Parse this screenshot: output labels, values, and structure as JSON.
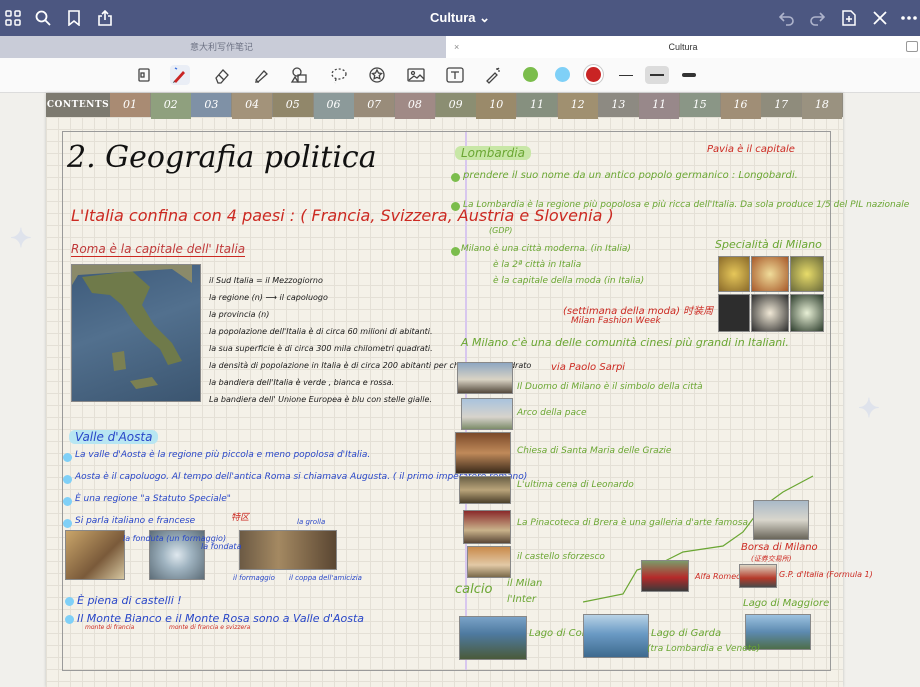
{
  "app": {
    "title": "Cultura",
    "tabs": [
      {
        "label": "意大利写作笔记"
      },
      {
        "label": "Cultura"
      }
    ]
  },
  "titlebar": {
    "icons": [
      "grid-icon",
      "search-icon",
      "bookmark-icon",
      "share-icon",
      "undo-icon",
      "redo-icon",
      "add-page-icon",
      "close-icon",
      "more-icon"
    ]
  },
  "toolbar": {
    "tools": [
      "reader-icon",
      "pen-icon",
      "eraser-icon",
      "highlighter-icon",
      "shapes-icon",
      "lasso-icon",
      "sticker-icon",
      "image-icon",
      "text-icon",
      "laser-icon"
    ],
    "colors": [
      "#7bbd4c",
      "#7fd0f7",
      "#c92424"
    ]
  },
  "notebook": {
    "tab_first": "CONTENTS",
    "tabs": [
      "01",
      "02",
      "03",
      "04",
      "05",
      "06",
      "07",
      "08",
      "09",
      "10",
      "11",
      "12",
      "13",
      "11",
      "15",
      "16",
      "17",
      "18"
    ]
  },
  "left": {
    "heading": "2. Geografia politica",
    "confini": "L'Italia confina con 4 paesi : ( Francia, Svizzera, Austria e Slovenia )",
    "roma": "Roma è la capitale dell' Italia",
    "facts": [
      "il Sud Italia = il Mezzogiorno",
      "la regione (n) ⟶ il capoluogo",
      "la provincia (n)",
      "la popolazione dell'Italia è di circa 60 milioni di abitanti.",
      "la sua superficie è di circa 300 mila chilometri quadrati.",
      "la densità di popolazione in Italia è di circa 200 abitanti per chilometro quadrato",
      "la bandiera dell'Italia è verde , bianca e rossa.",
      "La bandiera dell' Unione Europea è blu con stelle gialle."
    ],
    "aosta_heading": "Valle d'Aosta",
    "aosta": [
      "La valle d'Aosta è la regione più piccola e meno popolosa d'Italia.",
      "Aosta è il capoluogo. Al tempo dell'antica Roma si chiamava Augusta. ( il primo imperatore romano)",
      "È una regione \"a Statuto Speciale\"",
      "Si parla italiano e francese"
    ],
    "aosta_note": "特区",
    "aosta_labels": [
      "la fonduta (un formaggio)",
      "la fondata",
      "la grolla",
      "il formaggio",
      "il coppa dell'amicizia"
    ],
    "aosta_end": [
      "È piena di castelli !",
      "Il Monte Bianco e il Monte Rosa sono a Valle d'Aosta"
    ],
    "aosta_small": [
      "monte di francia",
      "monte di francia e svizzera"
    ]
  },
  "right": {
    "heading": "Lombardia",
    "pavia": "Pavia è il capitale",
    "lombardia": [
      "prendere il suo nome da un antico popolo germanico : Longobardi.",
      "La Lombardia è la regione più popolosa e più ricca dell'Italia. Da sola produce 1/5 del PIL nazionale",
      "(GDP)",
      "Milano è una città moderna. (in Italia)",
      "è la 2ª città in Italia",
      "è la capitale della moda (in Italia)"
    ],
    "settimana": "(settimana della moda) 时装周",
    "fashion_week": "Milan Fashion Week",
    "specialita": "Specialità di Milano",
    "milano_vie": "A Milano c'è una delle comunità cinesi più grandi in Italiani.",
    "via_paolo": "via Paolo Sarpi",
    "sights": [
      "Il Duomo di Milano è il simbolo della città",
      "Arco della pace",
      "Chiesa di Santa Maria delle Grazie",
      "L'ultima cena di Leonardo",
      "La Pinacoteca di Brera è una galleria d'arte famosa.",
      "il castello sforzesco"
    ],
    "calcio": "calcio",
    "clubs": [
      "il Milan",
      "l'Inter"
    ],
    "borsa": "Borsa di Milano",
    "borsa_note": "(证券交易所)",
    "alfa": "Alfa Romeo",
    "ferrari": "G.P. d'Italia (Formula 1)",
    "lago_mag": "Lago di Maggiore",
    "lago_como": "Lago di Como",
    "lago_garda": "Lago di Garda",
    "garda_note": "(tra Lombardia e Veneto)"
  }
}
